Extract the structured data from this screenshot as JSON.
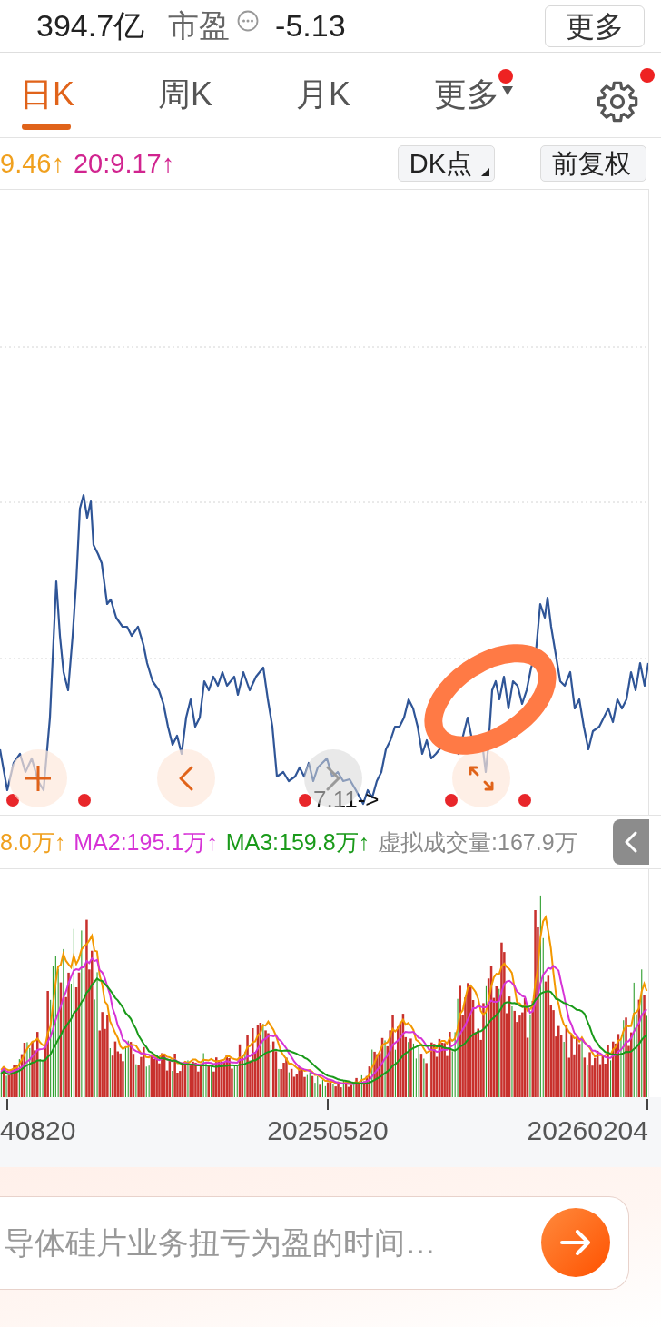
{
  "quote_bar": {
    "market_value": "394.7亿",
    "pe_label": "市盈",
    "pe_value": "-5.13",
    "more_button": "更多"
  },
  "period_tabs": [
    {
      "label": "日K",
      "selected": true,
      "has_menu": false,
      "notification_dot": false
    },
    {
      "label": "周K",
      "selected": false,
      "has_menu": false,
      "notification_dot": false
    },
    {
      "label": "月K",
      "selected": false,
      "has_menu": false,
      "notification_dot": false
    },
    {
      "label": "更多",
      "selected": false,
      "has_menu": true,
      "notification_dot": true
    }
  ],
  "settings_button": {
    "notification_dot": true
  },
  "price_legend": [
    {
      "text": "9.46↑",
      "color": "#f0a01e"
    },
    {
      "text": "20:9.17↑",
      "color": "#d1248f"
    }
  ],
  "chart_toolbar": {
    "dk_button": "DK点",
    "adjust_button": "前复权"
  },
  "overlay_buttons": [
    {
      "kind": "plus",
      "disabled": false
    },
    {
      "kind": "back",
      "disabled": false
    },
    {
      "kind": "forward",
      "disabled": true
    },
    {
      "kind": "expand",
      "disabled": false
    }
  ],
  "marker_label": "7.11->",
  "volume_legend": [
    {
      "text": "8.0万↑",
      "color": "#f0a01e"
    },
    {
      "text": "MA2:195.1万↑",
      "color": "#d633d6"
    },
    {
      "text": "MA3:159.8万↑",
      "color": "#1a9a1a"
    },
    {
      "text": "虚拟成交量:167.9万",
      "color": "#8a8a8a"
    }
  ],
  "x_axis_labels": [
    "40820",
    "20250520",
    "20260204"
  ],
  "question_box": {
    "placeholder": "导体硅片业务扭亏为盈的时间…"
  }
}
